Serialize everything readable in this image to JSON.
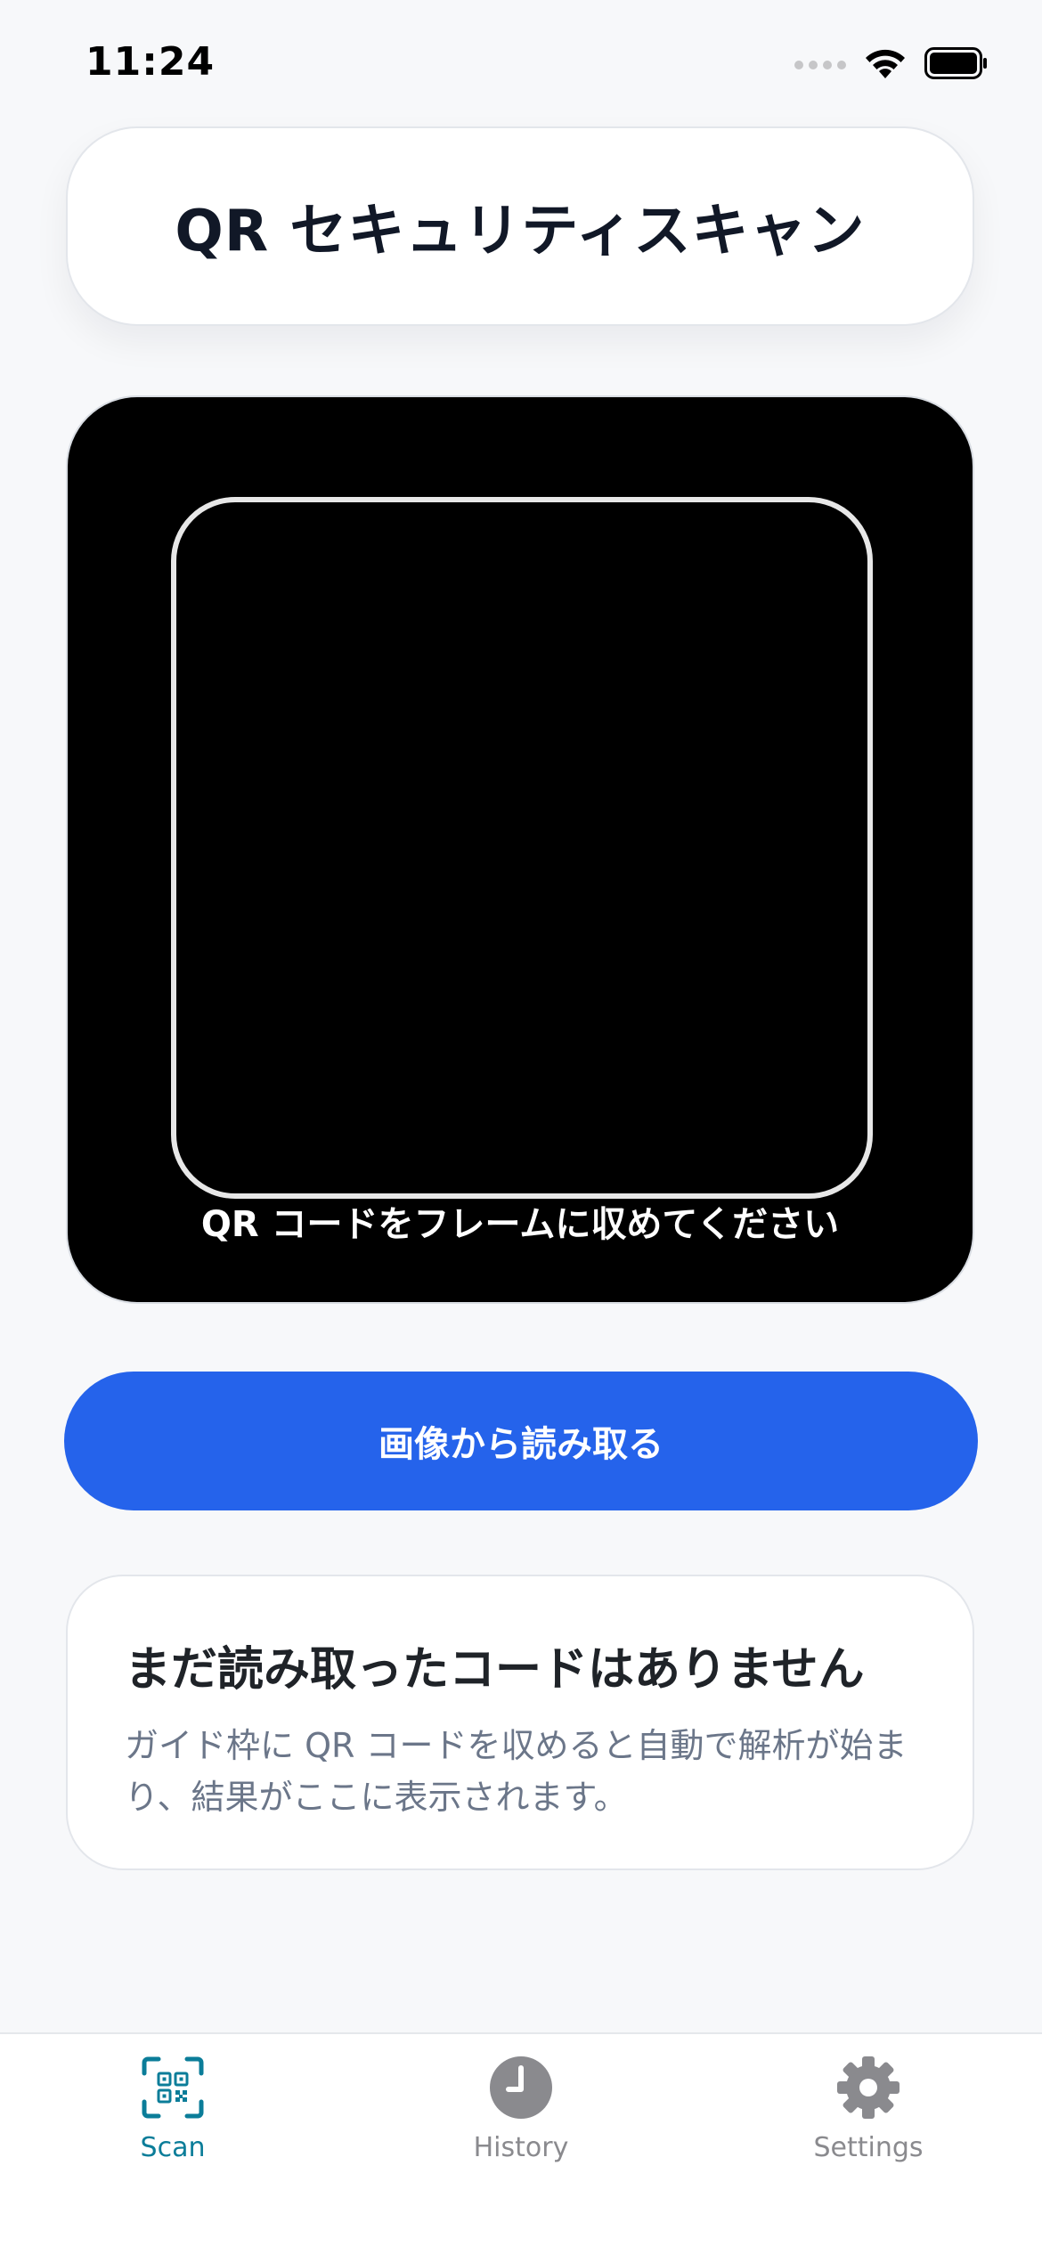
{
  "status_bar": {
    "time": "11:24"
  },
  "header": {
    "title": "QR セキュリティスキャン"
  },
  "camera": {
    "hint": "QR コードをフレームに収めてください"
  },
  "actions": {
    "read_from_image_label": "画像から読み取る"
  },
  "empty_state": {
    "title": "まだ読み取ったコードはありません",
    "description": "ガイド枠に QR コードを収めると自動で解析が始まり、結果がここに表示されます。"
  },
  "tab_bar": {
    "tabs": [
      {
        "label": "Scan",
        "icon": "qr-scan-icon",
        "active": true
      },
      {
        "label": "History",
        "icon": "clock-icon",
        "active": false
      },
      {
        "label": "Settings",
        "icon": "gear-icon",
        "active": false
      }
    ]
  },
  "colors": {
    "accent": "#2563eb",
    "active_tab": "#0b7d99",
    "inactive_tab": "#8a8a8e",
    "background": "#f7f8fa"
  }
}
